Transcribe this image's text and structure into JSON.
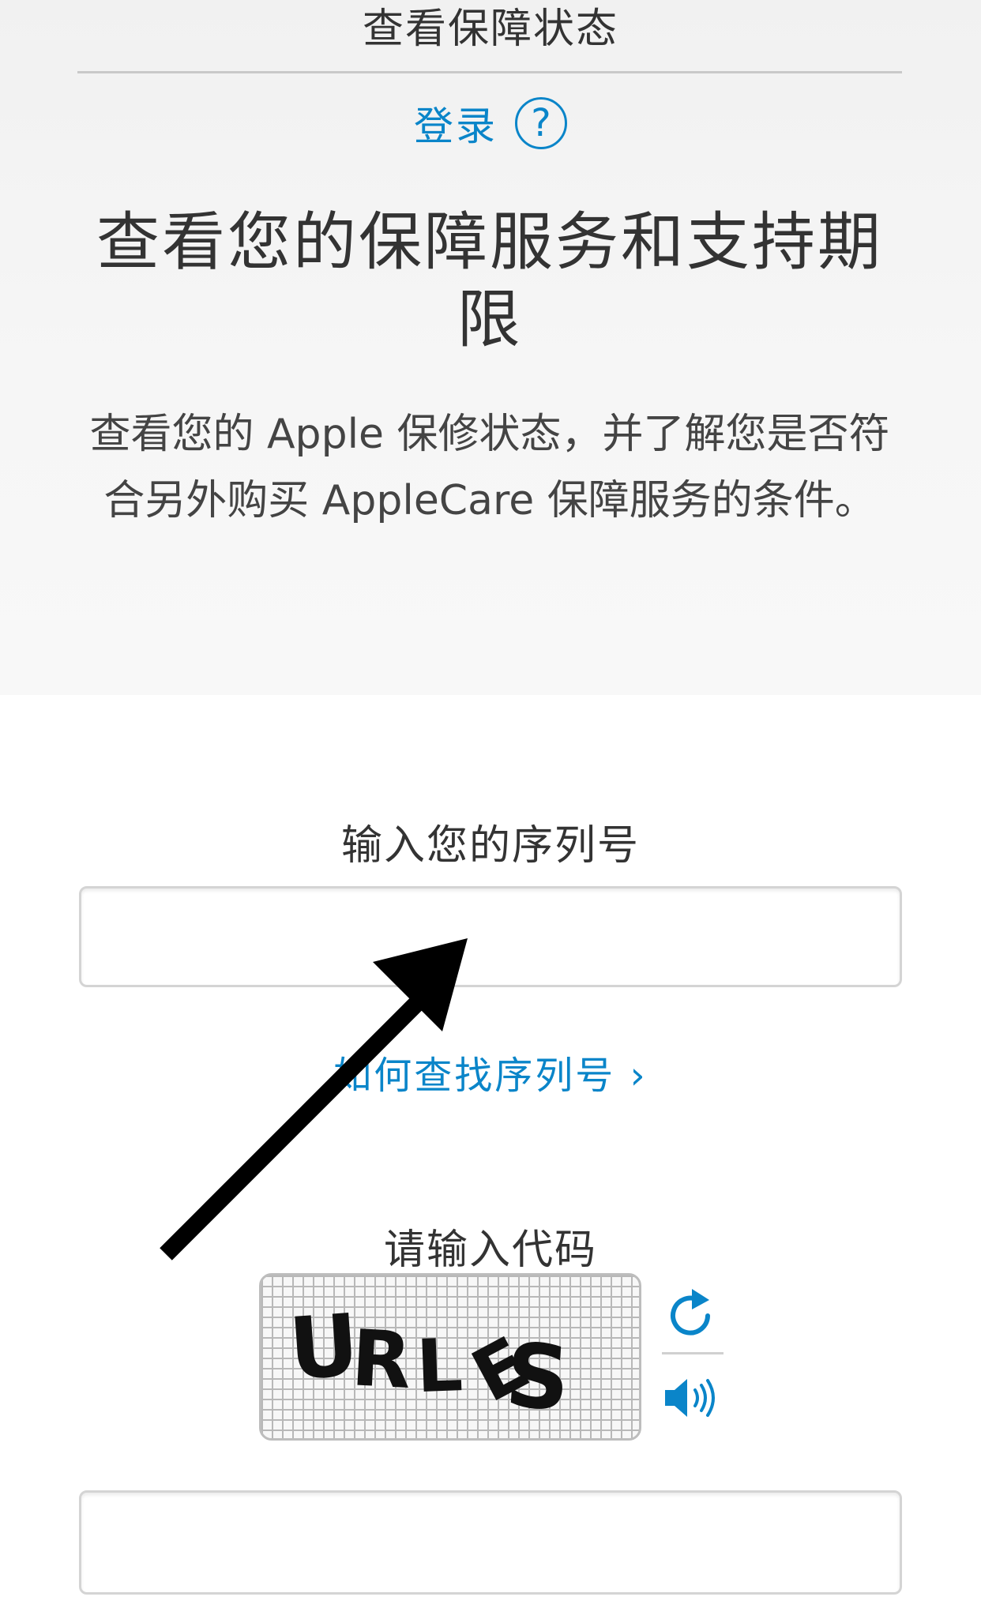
{
  "header": {
    "title": "查看保障状态",
    "login_label": "登录",
    "help_symbol": "?"
  },
  "hero": {
    "headline": "查看您的保障服务和支持期限",
    "description": "查看您的 Apple 保修状态，并了解您是否符合另外购买 AppleCare 保障服务的条件。"
  },
  "serial": {
    "label": "输入您的序列号",
    "value": "",
    "placeholder": "",
    "help_link": "如何查找序列号 ›"
  },
  "captcha": {
    "label": "请输入代码",
    "code_image_text": "URLES",
    "value": "",
    "placeholder": "",
    "refresh_icon": "refresh-icon",
    "audio_icon": "speaker-icon"
  },
  "colors": {
    "link": "#0a85c9",
    "text": "#333333",
    "hero_background": "#f3f3f3",
    "annotation_arrow": "#000000"
  }
}
